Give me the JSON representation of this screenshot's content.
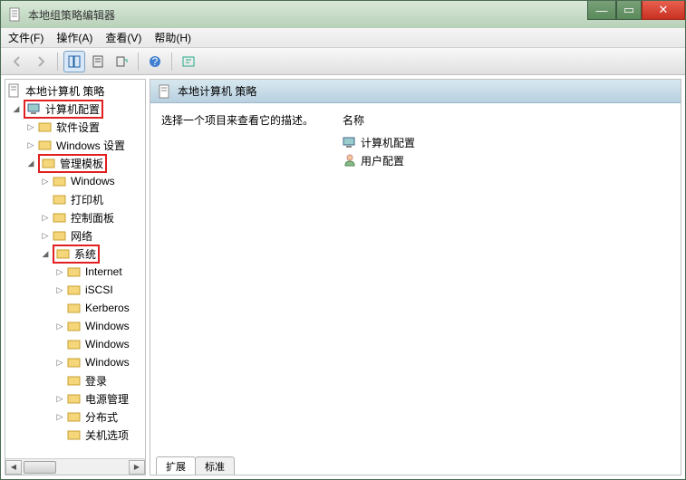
{
  "window": {
    "title": "本地组策略编辑器"
  },
  "win_controls": {
    "min": "—",
    "max": "▭",
    "close": "✕"
  },
  "menu": {
    "file": "文件(F)",
    "action": "操作(A)",
    "view": "查看(V)",
    "help": "帮助(H)"
  },
  "tree": {
    "root": "本地计算机 策略",
    "computer_config": "计算机配置",
    "software_settings": "软件设置",
    "windows_settings": "Windows 设置",
    "admin_templates": "管理模板",
    "windows": "Windows",
    "printer": "打印机",
    "control_panel": "控制面板",
    "network": "网络",
    "system": "系统",
    "internet": "Internet",
    "iscsi": "iSCSI",
    "kerberos": "Kerberos",
    "windows_c1": "Windows",
    "windows_c2": "Windows",
    "windows_c3": "Windows",
    "logon": "登录",
    "power": "电源管理",
    "dfs": "分布式",
    "shutdown": "关机选项"
  },
  "content": {
    "title": "本地计算机 策略",
    "description": "选择一个项目来查看它的描述。",
    "col_name": "名称",
    "items": {
      "computer_config": "计算机配置",
      "user_config": "用户配置"
    }
  },
  "tabs": {
    "extended": "扩展",
    "standard": "标准"
  }
}
